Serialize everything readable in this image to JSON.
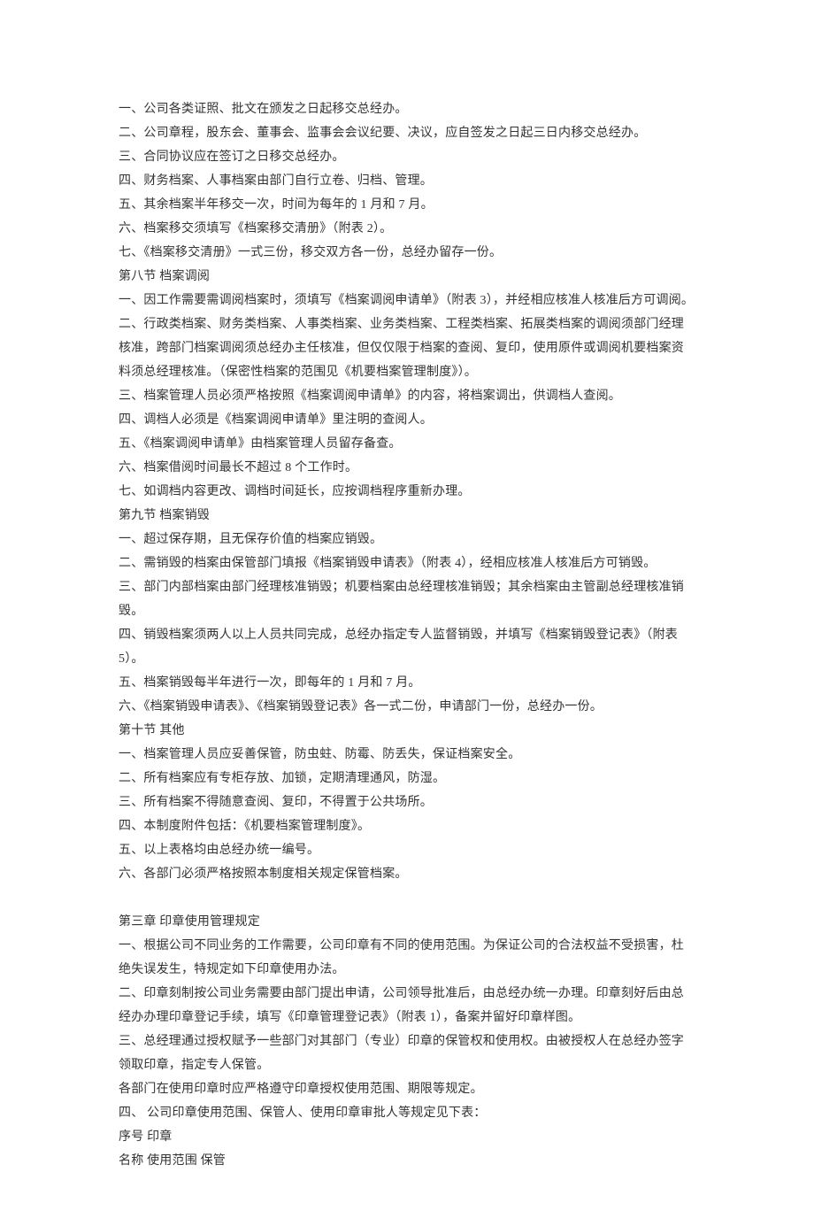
{
  "lines": [
    "一、公司各类证照、批文在颁发之日起移交总经办。",
    "二、公司章程，股东会、董事会、监事会会议纪要、决议，应自签发之日起三日内移交总经办。",
    "三、合同协议应在签订之日移交总经办。",
    "四、财务档案、人事档案由部门自行立卷、归档、管理。",
    "五、其余档案半年移交一次，时间为每年的 1 月和 7 月。",
    "六、档案移交须填写《档案移交清册》（附表 2）。",
    "七、《档案移交清册》一式三份，移交双方各一份，总经办留存一份。",
    "第八节 档案调阅",
    "一、因工作需要需调阅档案时，须填写《档案调阅申请单》（附表 3），并经相应核准人核准后方可调阅。",
    "二、行政类档案、财务类档案、人事类档案、业务类档案、工程类档案、拓展类档案的调阅须部门经理核准，跨部门档案调阅须总经办主任核准，但仅仅限于档案的查阅、复印，使用原件或调阅机要档案资料须总经理核准。（保密性档案的范围见《机要档案管理制度》）。",
    "三、档案管理人员必须严格按照《档案调阅申请单》的内容，将档案调出，供调档人查阅。",
    "四、调档人必须是《档案调阅申请单》里注明的查阅人。",
    "五、《档案调阅申请单》由档案管理人员留存备查。",
    "六、档案借阅时间最长不超过 8 个工作时。",
    "七、如调档内容更改、调档时间延长，应按调档程序重新办理。",
    "第九节 档案销毁",
    "一、超过保存期，且无保存价值的档案应销毁。",
    "二、需销毁的档案由保管部门填报《档案销毁申请表》（附表 4），经相应核准人核准后方可销毁。",
    "三、部门内部档案由部门经理核准销毁；机要档案由总经理核准销毁；其余档案由主管副总经理核准销毁。",
    "四、销毁档案须两人以上人员共同完成，总经办指定专人监督销毁，并填写《档案销毁登记表》（附表 5）。",
    "五、档案销毁每半年进行一次，即每年的 1 月和 7 月。",
    "六、《档案销毁申请表》、《档案销毁登记表》各一式二份，申请部门一份，总经办一份。",
    "第十节 其他",
    "一、档案管理人员应妥善保管，防虫蛀、防霉、防丢失，保证档案安全。",
    "二、所有档案应有专柜存放、加锁，定期清理通风，防湿。",
    "三、所有档案不得随意查阅、复印，不得置于公共场所。",
    "四、本制度附件包括：《机要档案管理制度》。",
    "五、以上表格均由总经办统一编号。",
    "六、各部门必须严格按照本制度相关规定保管档案。",
    "",
    "第三章 印章使用管理规定",
    "一、根据公司不同业务的工作需要，公司印章有不同的使用范围。为保证公司的合法权益不受损害，杜绝失误发生，特规定如下印章使用办法。",
    "二、印章刻制按公司业务需要由部门提出申请，公司领导批准后，由总经办统一办理。印章刻好后由总经办办理印章登记手续，填写《印章管理登记表》（附表 1），备案并留好印章样图。",
    "三、总经理通过授权赋予一些部门对其部门（专业）印章的保管权和使用权。由被授权人在总经办签字领取印章，指定专人保管。",
    "各部门在使用印章时应严格遵守印章授权使用范围、期限等规定。",
    "四、 公司印章使用范围、保管人、使用印章审批人等规定见下表：",
    "序号 印章",
    "名称 使用范围 保管"
  ]
}
